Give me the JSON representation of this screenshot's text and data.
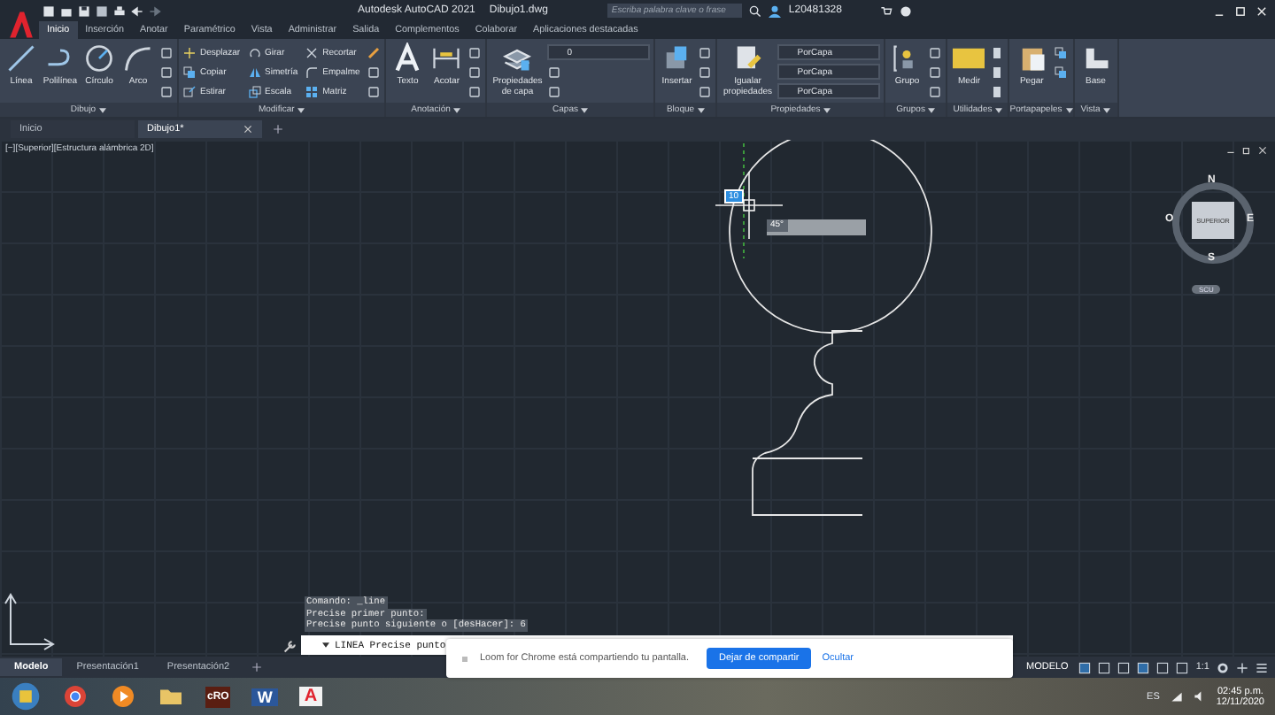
{
  "app_bar": {
    "title": "Autodesk AutoCAD 2021",
    "file": "Dibujo1.dwg",
    "search": {
      "placeholder": "Escriba palabra clave o frase"
    },
    "user": "L20481328"
  },
  "ribbon_tabs": [
    {
      "label": "Inicio",
      "selected": true
    },
    {
      "label": "Inserción",
      "selected": false
    },
    {
      "label": "Anotar",
      "selected": false
    },
    {
      "label": "Paramétrico",
      "selected": false
    },
    {
      "label": "Vista",
      "selected": false
    },
    {
      "label": "Administrar",
      "selected": false
    },
    {
      "label": "Salida",
      "selected": false
    },
    {
      "label": "Complementos",
      "selected": false
    },
    {
      "label": "Colaborar",
      "selected": false
    },
    {
      "label": "Aplicaciones destacadas",
      "selected": false
    }
  ],
  "ribbon_panels": [
    {
      "title": "Dibujo",
      "tools": [
        {
          "kind": "large",
          "label": "Línea"
        },
        {
          "kind": "large",
          "label": "Polilínea"
        },
        {
          "kind": "large",
          "label": "Círculo"
        },
        {
          "kind": "large",
          "label": "Arco"
        },
        {
          "kind": "icon"
        },
        {
          "kind": "icon"
        },
        {
          "kind": "icon"
        }
      ]
    },
    {
      "title": "Modificar",
      "tools": [
        {
          "kind": "small",
          "label": "Desplazar"
        },
        {
          "kind": "small",
          "label": "Copiar"
        },
        {
          "kind": "small",
          "label": "Estirar"
        },
        {
          "kind": "small",
          "label": "Girar"
        },
        {
          "kind": "small",
          "label": "Simetría"
        },
        {
          "kind": "small",
          "label": "Escala"
        },
        {
          "kind": "small",
          "label": "Recortar"
        },
        {
          "kind": "small",
          "label": "Empalme"
        },
        {
          "kind": "small",
          "label": "Matriz"
        },
        {
          "kind": "icon"
        },
        {
          "kind": "icon"
        },
        {
          "kind": "icon"
        }
      ]
    },
    {
      "title": "Anotación",
      "tools": [
        {
          "kind": "large",
          "label": "Texto"
        },
        {
          "kind": "large",
          "label": "Acotar"
        },
        {
          "kind": "icon"
        },
        {
          "kind": "icon"
        },
        {
          "kind": "icon"
        }
      ]
    },
    {
      "title": "Capas",
      "tools": [
        {
          "kind": "large",
          "label": "Propiedades de capa"
        },
        {
          "kind": "dropdown",
          "label": "0"
        },
        {
          "kind": "icon"
        },
        {
          "kind": "icon"
        }
      ]
    },
    {
      "title": "Bloque",
      "tools": [
        {
          "kind": "large",
          "label": "Insertar"
        },
        {
          "kind": "icon"
        },
        {
          "kind": "icon"
        },
        {
          "kind": "icon"
        }
      ]
    },
    {
      "title": "Propiedades",
      "tools": [
        {
          "kind": "large",
          "label": "Igualar propiedades"
        },
        {
          "kind": "dropdown",
          "label": "PorCapa"
        },
        {
          "kind": "dropdown",
          "label": "PorCapa"
        },
        {
          "kind": "dropdown",
          "label": "PorCapa"
        }
      ]
    },
    {
      "title": "Grupos",
      "tools": [
        {
          "kind": "large",
          "label": "Grupo"
        },
        {
          "kind": "icon"
        },
        {
          "kind": "icon"
        },
        {
          "kind": "icon"
        }
      ]
    },
    {
      "title": "Utilidades",
      "tools": [
        {
          "kind": "large",
          "label": "Medir"
        },
        {
          "kind": "icon"
        },
        {
          "kind": "icon"
        },
        {
          "kind": "icon"
        }
      ]
    },
    {
      "title": "Portapapeles",
      "tools": [
        {
          "kind": "large",
          "label": "Pegar"
        },
        {
          "kind": "icon"
        },
        {
          "kind": "icon"
        }
      ]
    },
    {
      "title": "Vista",
      "tools": [
        {
          "kind": "large",
          "label": "Base"
        }
      ]
    }
  ],
  "file_tabs": [
    {
      "label": "Inicio",
      "selected": false
    },
    {
      "label": "Dibujo1*",
      "selected": true
    }
  ],
  "viewport": {
    "label": "[−][Superior][Estructura alámbrica 2D]",
    "dynamic_input": "10",
    "angle": "45°",
    "viewcube": {
      "north": "N",
      "south": "S",
      "east": "E",
      "west": "O",
      "face": "SUPERIOR",
      "ucs": "SCU"
    }
  },
  "command_history": [
    "Comando: _line",
    "Precise primer punto:",
    "Precise punto siguiente o [desHacer]: 6"
  ],
  "command_line": {
    "value": "LINEA Precise punto"
  },
  "notification": {
    "message": "Loom for Chrome está compartiendo tu pantalla.",
    "button": "Dejar de compartir",
    "link": "Ocultar"
  },
  "layout_tabs": [
    {
      "label": "Modelo",
      "selected": true
    },
    {
      "label": "Presentación1",
      "selected": false
    },
    {
      "label": "Presentación2",
      "selected": false
    }
  ],
  "status_bar": {
    "space": "MODELO",
    "scale": "1:1"
  },
  "taskbar": {
    "apps": [
      {
        "kind": "browser"
      },
      {
        "kind": "media"
      },
      {
        "kind": "folder"
      },
      {
        "kind": "tile",
        "label": "cRO"
      },
      {
        "kind": "word",
        "label": "W"
      },
      {
        "kind": "cad",
        "label": "A"
      }
    ],
    "language": "ES",
    "time": "02:45 p.m.",
    "date": "12/11/2020"
  }
}
